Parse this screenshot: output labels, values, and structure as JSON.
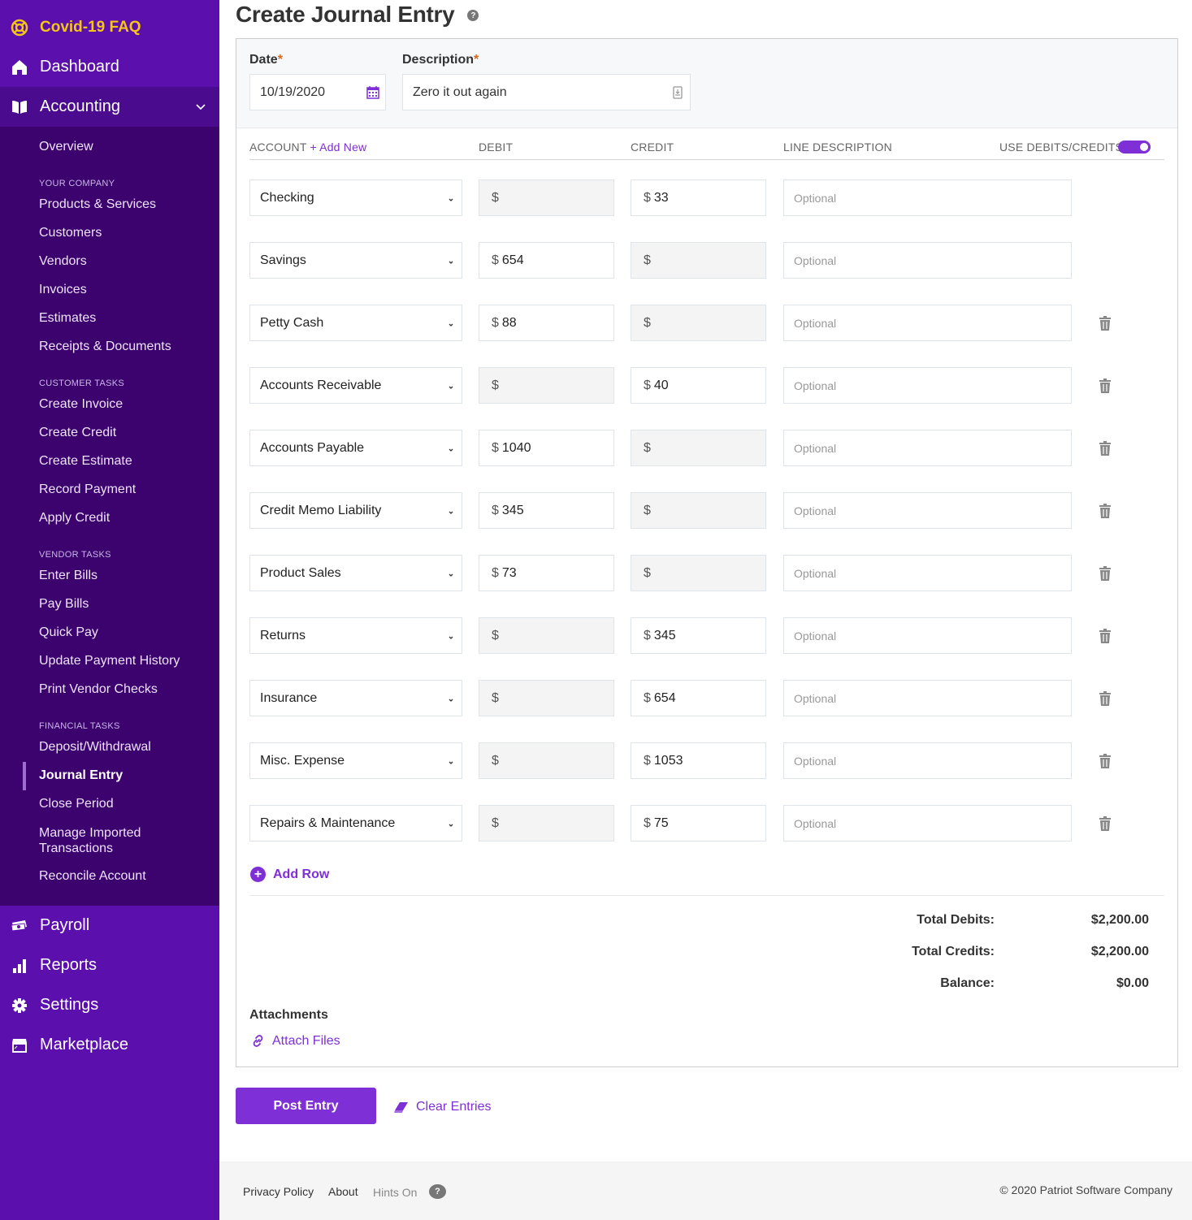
{
  "sidebar": {
    "covid_faq": "Covid-19 FAQ",
    "dashboard": "Dashboard",
    "accounting": "Accounting",
    "accounting_items": {
      "overview": "Overview",
      "your_company_header": "YOUR COMPANY",
      "your_company": [
        "Products & Services",
        "Customers",
        "Vendors",
        "Invoices",
        "Estimates",
        "Receipts & Documents"
      ],
      "customer_tasks_header": "CUSTOMER TASKS",
      "customer_tasks": [
        "Create Invoice",
        "Create Credit",
        "Create Estimate",
        "Record Payment",
        "Apply Credit"
      ],
      "vendor_tasks_header": "VENDOR TASKS",
      "vendor_tasks": [
        "Enter Bills",
        "Pay Bills",
        "Quick Pay",
        "Update Payment History",
        "Print Vendor Checks"
      ],
      "financial_tasks_header": "FINANCIAL TASKS",
      "financial_tasks": [
        "Deposit/Withdrawal",
        "Journal Entry",
        "Close Period",
        "Manage Imported Transactions",
        "Reconcile Account"
      ],
      "active_item": "Journal Entry"
    },
    "payroll": "Payroll",
    "reports": "Reports",
    "settings": "Settings",
    "marketplace": "Marketplace"
  },
  "page": {
    "title": "Create Journal Entry",
    "help_icon": "?"
  },
  "form": {
    "date_label": "Date",
    "description_label": "Description",
    "required_mark": "*",
    "date_value": "10/19/2020",
    "description_value": "Zero it out again"
  },
  "table": {
    "headers": {
      "account": "ACCOUNT",
      "add_new": "+ Add New",
      "debit": "DEBIT",
      "credit": "CREDIT",
      "line_description": "LINE DESCRIPTION",
      "use_debits_credits": "USE DEBITS/CREDITS"
    },
    "use_debits_credits_enabled": true,
    "currency_symbol": "$",
    "line_description_placeholder": "Optional",
    "rows": [
      {
        "account": "Checking",
        "debit": "",
        "credit": "33",
        "deletable": false
      },
      {
        "account": "Savings",
        "debit": "654",
        "credit": "",
        "deletable": false
      },
      {
        "account": "Petty Cash",
        "debit": "88",
        "credit": "",
        "deletable": true
      },
      {
        "account": "Accounts Receivable",
        "debit": "",
        "credit": "40",
        "deletable": true
      },
      {
        "account": "Accounts Payable",
        "debit": "1040",
        "credit": "",
        "deletable": true
      },
      {
        "account": "Credit Memo Liability",
        "debit": "345",
        "credit": "",
        "deletable": true
      },
      {
        "account": "Product Sales",
        "debit": "73",
        "credit": "",
        "deletable": true
      },
      {
        "account": "Returns",
        "debit": "",
        "credit": "345",
        "deletable": true
      },
      {
        "account": "Insurance",
        "debit": "",
        "credit": "654",
        "deletable": true
      },
      {
        "account": "Misc. Expense",
        "debit": "",
        "credit": "1053",
        "deletable": true
      },
      {
        "account": "Repairs & Maintenance",
        "debit": "",
        "credit": "75",
        "deletable": true
      }
    ],
    "add_row_label": "Add Row"
  },
  "totals": {
    "total_debits_label": "Total Debits:",
    "total_debits_value": "$2,200.00",
    "total_credits_label": "Total Credits:",
    "total_credits_value": "$2,200.00",
    "balance_label": "Balance:",
    "balance_value": "$0.00"
  },
  "attachments": {
    "label": "Attachments",
    "attach_files": "Attach Files"
  },
  "actions": {
    "post_entry": "Post Entry",
    "clear_entries": "Clear Entries"
  },
  "footer": {
    "privacy_policy": "Privacy Policy",
    "about": "About",
    "hints": "Hints On",
    "hints_icon": "?",
    "copyright": "© 2020 Patriot Software Company"
  },
  "colors": {
    "sidebar_bg": "#5b0fad",
    "subnav_bg": "#3c036f",
    "accent": "#7f2fd6",
    "covid_link": "#f5c518"
  }
}
